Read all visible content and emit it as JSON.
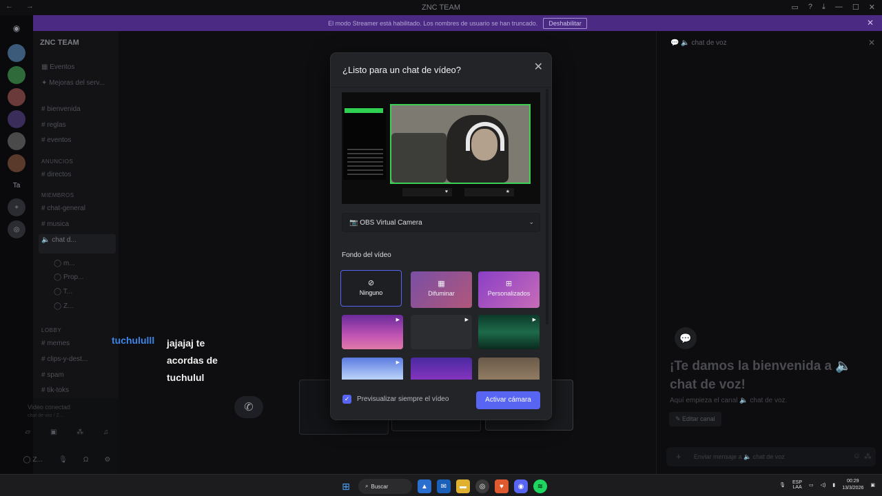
{
  "window": {
    "title": "ZNC TEAM"
  },
  "banner": {
    "text": "El modo Streamer está habilitado. Los nombres de usuario se han truncado.",
    "button": "Deshabilitar"
  },
  "server": {
    "name": "ZNC TEAM",
    "channels": [
      {
        "label": "Eventos"
      },
      {
        "label": "Mejoras del serv..."
      },
      {
        "label": "bienvenida"
      },
      {
        "label": "reglas"
      },
      {
        "label": "eventos"
      },
      {
        "label": "ANUNCIOS"
      },
      {
        "label": "directos"
      },
      {
        "label": "MIEMBROS"
      },
      {
        "label": "chat-general"
      },
      {
        "label": "musica"
      },
      {
        "label": "chat d..."
      },
      {
        "label": "LOBBY"
      },
      {
        "label": "memes"
      },
      {
        "label": "clips-y-dest..."
      },
      {
        "label": "spam"
      },
      {
        "label": "tik-toks"
      }
    ],
    "voice_status": {
      "title": "Video conectad",
      "sub": "chat de voz / Z..."
    }
  },
  "overlay": {
    "user": "tuchululll",
    "message": "jajajaj te acordas de tuchulul"
  },
  "modal": {
    "title": "¿Listo para un chat de vídeo?",
    "camera": "OBS Virtual Camera",
    "bg_section": "Fondo del vídeo",
    "options": [
      {
        "label": "Ninguno",
        "icon": "⊘"
      },
      {
        "label": "Difuminar",
        "icon": "▦"
      },
      {
        "label": "Personalizados",
        "icon": "⊞"
      }
    ],
    "checkbox_label": "Previsualizar siempre el vídeo",
    "primary": "Activar cámara"
  },
  "right_panel": {
    "header": "chat de voz",
    "welcome_title": "¡Te damos la bienvenida a 🔈 chat de voz!",
    "welcome_sub": "Aquí empieza el canal 🔈 chat de voz.",
    "edit_button": "Editar canal",
    "input_placeholder": "Enviar mensaje a 🔈 chat de voz"
  },
  "taskbar": {
    "search": "Buscar",
    "lang": "ESP",
    "lang2": "LAA",
    "time": "00:29",
    "date": "13/3/2026"
  },
  "colors": {
    "accent": "#5865f2",
    "banner": "#4b2a84",
    "cam_border": "#3ad154",
    "overlay_name": "#3d86e8"
  }
}
